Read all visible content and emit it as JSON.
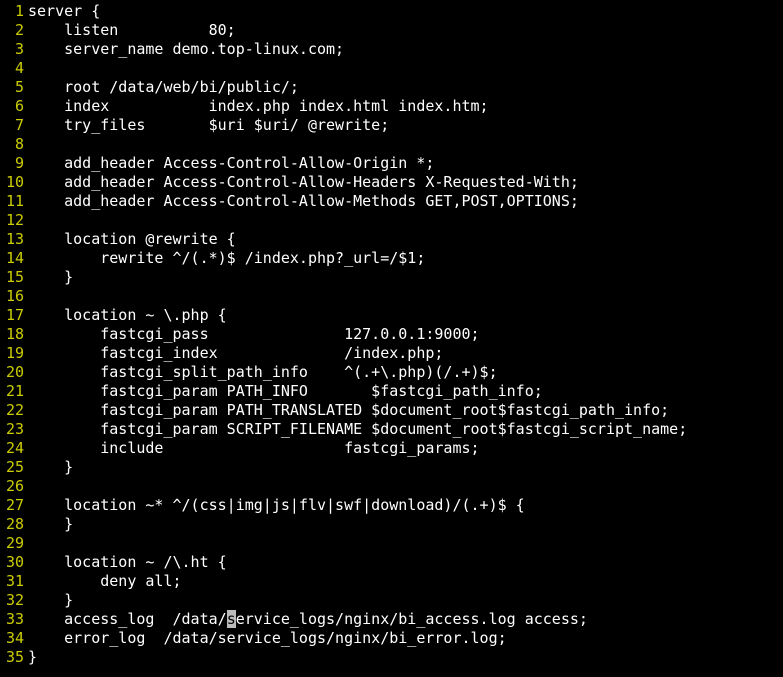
{
  "lines": [
    "server {",
    "    listen          80;",
    "    server_name demo.top-linux.com;",
    "",
    "    root /data/web/bi/public/;",
    "    index           index.php index.html index.htm;",
    "    try_files       $uri $uri/ @rewrite;",
    "",
    "    add_header Access-Control-Allow-Origin *;",
    "    add_header Access-Control-Allow-Headers X-Requested-With;",
    "    add_header Access-Control-Allow-Methods GET,POST,OPTIONS;",
    "",
    "    location @rewrite {",
    "        rewrite ^/(.*)$ /index.php?_url=/$1;",
    "    }",
    "",
    "    location ~ \\.php {",
    "        fastcgi_pass               127.0.0.1:9000;",
    "        fastcgi_index              /index.php;",
    "        fastcgi_split_path_info    ^(.+\\.php)(/.+)$;",
    "        fastcgi_param PATH_INFO       $fastcgi_path_info;",
    "        fastcgi_param PATH_TRANSLATED $document_root$fastcgi_path_info;",
    "        fastcgi_param SCRIPT_FILENAME $document_root$fastcgi_script_name;",
    "        include                    fastcgi_params;",
    "    }",
    "",
    "    location ~* ^/(css|img|js|flv|swf|download)/(.+)$ {",
    "    }",
    "",
    "    location ~ /\\.ht {",
    "        deny all;",
    "    }",
    "    access_log  /data/service_logs/nginx/bi_access.log access;",
    "    error_log  /data/service_logs/nginx/bi_error.log;",
    "}"
  ],
  "cursor": {
    "line": 33,
    "col": 22
  }
}
